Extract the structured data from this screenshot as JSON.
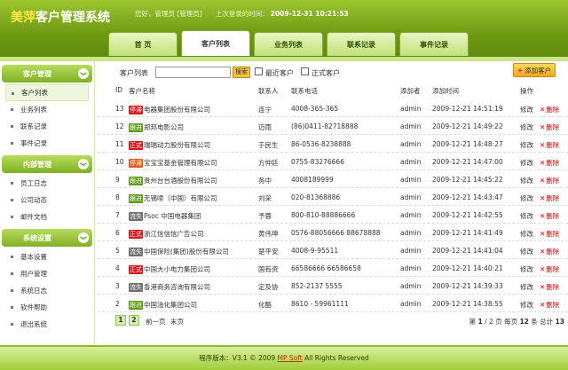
{
  "header": {
    "logo_accent": "美萍",
    "logo_rest": "客户管理系统",
    "welcome": "您好，管理员 [管理员]",
    "last_login_label": "上次登录的时间：",
    "last_login_time": "2009-12-31 10:21:53"
  },
  "tabs": [
    "首 页",
    "客户列表",
    "业务列表",
    "联系记录",
    "事件记录"
  ],
  "sidebar": [
    {
      "title": "客户管理",
      "items": [
        "客户列表",
        "业务列表",
        "联系记录",
        "事件记录"
      ]
    },
    {
      "title": "内部管理",
      "items": [
        "员工日志",
        "公司动态",
        "邮件文档"
      ]
    },
    {
      "title": "系统设置",
      "items": [
        "基本设置",
        "用户管理",
        "系统日志",
        "软件帮助",
        "退出系统"
      ]
    }
  ],
  "toolbar": {
    "label": "客户列表",
    "search": "搜索",
    "recent": "最近客户",
    "formal": "正式客户",
    "add": "添加客户"
  },
  "table": {
    "headers": [
      "ID",
      "客户名称",
      "联系人",
      "联系电话",
      "添加者",
      "添加时间",
      "操作"
    ],
    "rows": [
      {
        "id": "13",
        "tag": "停滞",
        "tagc": "b-red",
        "name": "电器集团股份有限公司",
        "contact": "连宁",
        "phone": "4008-365-365",
        "adder": "admin",
        "time": "2009-12-21 14:51:19"
      },
      {
        "id": "12",
        "tag": "跟进",
        "tagc": "b-grn",
        "name": "郑邦电影公司",
        "contact": "迈雨",
        "phone": "(86)0411-82718888",
        "adder": "admin",
        "time": "2009-12-21 14:49:22"
      },
      {
        "id": "11",
        "tag": "正式",
        "tagc": "b-red",
        "name": "瑞瑞动力股份有限公司",
        "contact": "于民生",
        "phone": "86-0536-8238888",
        "adder": "admin",
        "time": "2009-12-21 14:48:27"
      },
      {
        "id": "10",
        "tag": "停滞",
        "tagc": "b-org",
        "name": "宝宝宝基金管理有限公司",
        "contact": "方仲廷",
        "phone": "0755-83276666",
        "adder": "admin",
        "time": "2009-12-21 14:47:00"
      },
      {
        "id": "9",
        "tag": "跟进",
        "tagc": "b-grn",
        "name": "贵州台台酒股份有限公司",
        "contact": "务中",
        "phone": "4008189999",
        "adder": "admin",
        "time": "2009-12-21 14:45:22"
      },
      {
        "id": "8",
        "tag": "跟进",
        "tagc": "b-grn",
        "name": "无锡嗦（中国）有限公司",
        "contact": "刘采",
        "phone": "020-81368886",
        "adder": "admin",
        "time": "2009-12-21 14:43:47"
      },
      {
        "id": "7",
        "tag": "流失",
        "tagc": "b-gry",
        "name": "Psoc 中国电器集团",
        "contact": "予蓉",
        "phone": "800-810-88886666",
        "adder": "admin",
        "time": "2009-12-21 14:42:55"
      },
      {
        "id": "6",
        "tag": "正式",
        "tagc": "b-red",
        "name": "浙江信信信广告公司",
        "contact": "黄伟坤",
        "phone": "0576-88056666 88678888",
        "adder": "admin",
        "time": "2009-12-21 14:41:49"
      },
      {
        "id": "5",
        "tag": "流失",
        "tagc": "b-gry",
        "name": "中国保险(集团)股份有限公司",
        "contact": "楚平安",
        "phone": "4008-9-95511",
        "adder": "admin",
        "time": "2009-12-21 14:41:04"
      },
      {
        "id": "4",
        "tag": "正式",
        "tagc": "b-red",
        "name": "中国大小电力集团公司",
        "contact": "国有资",
        "phone": "66586666 66586658",
        "adder": "admin",
        "time": "2009-12-21 14:40:21"
      },
      {
        "id": "3",
        "tag": "流失",
        "tagc": "b-gry",
        "name": "香港商务咨询有限公司",
        "contact": "定及协",
        "phone": "852-2137 5555",
        "adder": "admin",
        "time": "2009-12-21 14:39:33"
      },
      {
        "id": "2",
        "tag": "跟进",
        "tagc": "b-grn",
        "name": "中国油化集团公司",
        "contact": "化酪",
        "phone": "8610 - 59961111",
        "adder": "admin",
        "time": "2009-12-21 14:38:55"
      }
    ],
    "edit": "修改",
    "del": "删除"
  },
  "pager": {
    "p1": "1",
    "p2": "2",
    "prev": "前一页",
    "last": "末页",
    "info_a": "第 ",
    "cur": "1",
    "info_b": " / 2 页  每页 ",
    "per": "12",
    "info_c": " 条  总计 ",
    "total": "13"
  },
  "footer": {
    "pre": "程序版本：V3.1 © 2009 ",
    "brand": "MP Soft",
    "post": " All Rights Reserved"
  }
}
